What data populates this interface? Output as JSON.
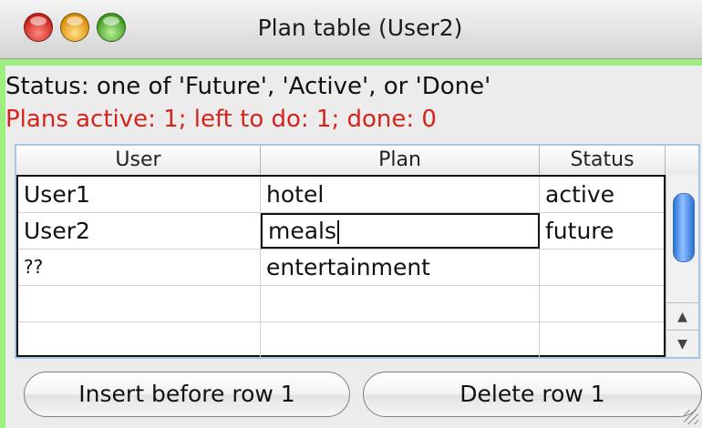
{
  "window": {
    "title": "Plan table (User2)"
  },
  "info": {
    "status_text": "Status: one of 'Future', 'Active', or 'Done'",
    "plans_text": "Plans active: 1; left to do: 1; done: 0",
    "plans_color": "#d4241b"
  },
  "table": {
    "columns": [
      "User",
      "Plan",
      "Status"
    ],
    "rows": [
      [
        "User1",
        "hotel",
        "active"
      ],
      [
        "User2",
        "meals",
        "future"
      ],
      [
        "??",
        "entertainment",
        ""
      ],
      [
        "",
        "",
        ""
      ],
      [
        "",
        "",
        ""
      ]
    ],
    "editing_cell": {
      "row": 2,
      "column": "Plan"
    }
  },
  "scrollbar": {
    "up_arrow": "▲",
    "down_arrow": "▼"
  },
  "buttons": {
    "insert_label": "Insert before row 1",
    "delete_label": "Delete row 1"
  },
  "colors": {
    "frame_green": "#9cee7e",
    "table_border_blue": "#a8c4e6",
    "scroll_thumb_blue": "#2f72d4"
  }
}
